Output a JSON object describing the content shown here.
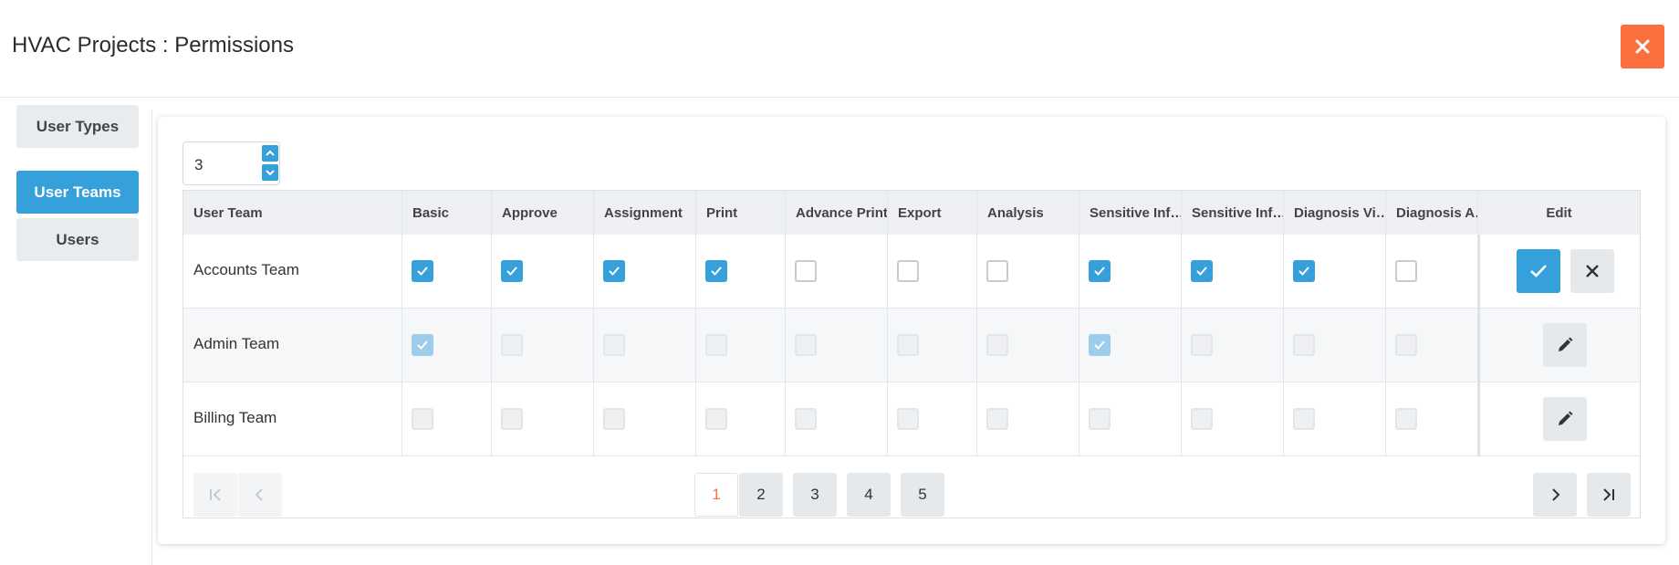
{
  "header": {
    "title": "HVAC Projects : Permissions",
    "close_icon": "close-icon"
  },
  "sidebar": {
    "items": [
      {
        "label": "User Types",
        "active": false
      },
      {
        "label": "User Teams",
        "active": true
      },
      {
        "label": "Users",
        "active": false
      }
    ]
  },
  "page_size": {
    "value": "3"
  },
  "table": {
    "columns": [
      "User Team",
      "Basic",
      "Approve",
      "Assignment",
      "Print",
      "Advance Print",
      "Export",
      "Analysis",
      "Sensitive Inf…",
      "Sensitive Inf…",
      "Diagnosis Vi…",
      "Diagnosis A…",
      "Edit"
    ],
    "rows": [
      {
        "team": "Accounts Team",
        "mode": "editing",
        "perms": [
          true,
          true,
          true,
          true,
          false,
          false,
          false,
          true,
          true,
          true,
          false
        ]
      },
      {
        "team": "Admin Team",
        "mode": "view",
        "perms": [
          true,
          false,
          false,
          false,
          false,
          false,
          false,
          true,
          false,
          false,
          false
        ]
      },
      {
        "team": "Billing Team",
        "mode": "view",
        "perms": [
          false,
          false,
          false,
          false,
          false,
          false,
          false,
          false,
          false,
          false,
          false
        ]
      }
    ]
  },
  "pager": {
    "pages": [
      "1",
      "2",
      "3",
      "4",
      "5"
    ],
    "current": "1"
  },
  "colors": {
    "accent": "#35a0da",
    "close": "#fb6f3f",
    "current_page": "#fb6f3f"
  }
}
